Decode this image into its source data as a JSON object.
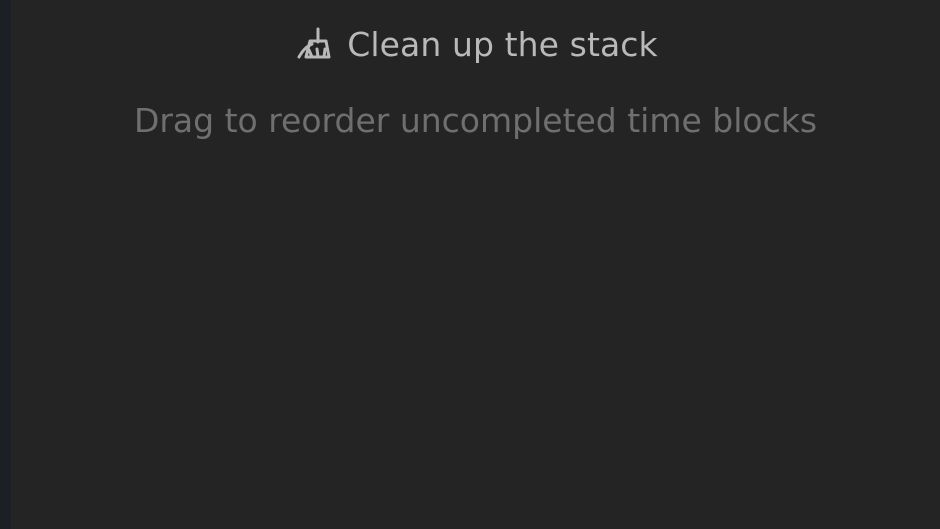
{
  "panel": {
    "title": "Clean up the stack",
    "subtitle": "Drag to reorder uncompleted time blocks",
    "icon": "broom-icon"
  },
  "colors": {
    "background": "#242424",
    "sidebar_edge": "#1c1f23",
    "title_text": "#b9b9b9",
    "subtitle_text": "#6f6f6f"
  }
}
